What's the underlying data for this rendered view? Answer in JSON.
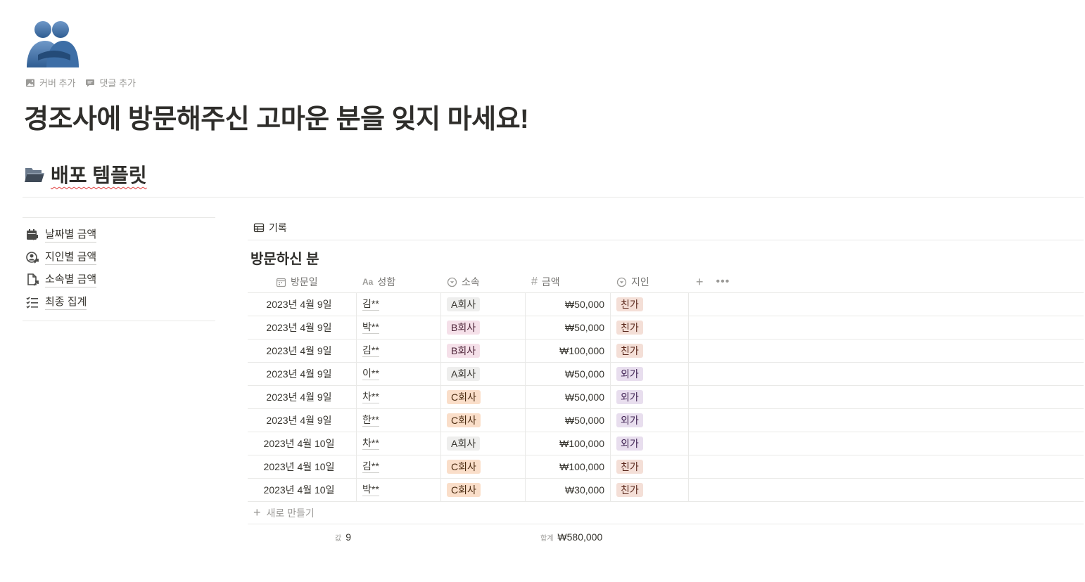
{
  "page": {
    "title": "경조사에 방문해주신 고마운 분을 잊지 마세요!",
    "add_cover": "커버 추가",
    "add_comment": "댓글 추가",
    "icon": "people-hugging-icon"
  },
  "section": {
    "icon": "open-folder-icon",
    "title": "배포 템플릿"
  },
  "sidebar": {
    "items": [
      {
        "label": "날짜별 금액",
        "icon": "calendar-link-icon"
      },
      {
        "label": "지인별 금액",
        "icon": "person-link-icon"
      },
      {
        "label": "소속별 금액",
        "icon": "document-link-icon"
      },
      {
        "label": "최종 집계",
        "icon": "checklist-icon"
      }
    ]
  },
  "database": {
    "view_tab": "기록",
    "title": "방문하신 분",
    "columns": {
      "date": "방문일",
      "name_prefix": "Aa",
      "name": "성함",
      "org": "소속",
      "amount": "금액",
      "relation": "지인"
    },
    "rows": [
      {
        "date": "2023년 4월 9일",
        "name": "김**",
        "org": "A회사",
        "amount": "₩50,000",
        "relation": "친가"
      },
      {
        "date": "2023년 4월 9일",
        "name": "박**",
        "org": "B회사",
        "amount": "₩50,000",
        "relation": "친가"
      },
      {
        "date": "2023년 4월 9일",
        "name": "김**",
        "org": "B회사",
        "amount": "₩100,000",
        "relation": "친가"
      },
      {
        "date": "2023년 4월 9일",
        "name": "이**",
        "org": "A회사",
        "amount": "₩50,000",
        "relation": "외가"
      },
      {
        "date": "2023년 4월 9일",
        "name": "차**",
        "org": "C회사",
        "amount": "₩50,000",
        "relation": "외가"
      },
      {
        "date": "2023년 4월 9일",
        "name": "한**",
        "org": "C회사",
        "amount": "₩50,000",
        "relation": "외가"
      },
      {
        "date": "2023년 4월 10일",
        "name": "차**",
        "org": "A회사",
        "amount": "₩100,000",
        "relation": "외가"
      },
      {
        "date": "2023년 4월 10일",
        "name": "김**",
        "org": "C회사",
        "amount": "₩100,000",
        "relation": "친가"
      },
      {
        "date": "2023년 4월 10일",
        "name": "박**",
        "org": "C회사",
        "amount": "₩30,000",
        "relation": "친가"
      }
    ],
    "new_row": "새로 만들기",
    "count_label": "값",
    "count_value": "9",
    "sum_label": "합계",
    "sum_value": "₩580,000"
  },
  "tag_colors": {
    "A회사": {
      "bg": "#eeeeed",
      "fg": "#37352f"
    },
    "B회사": {
      "bg": "#f5e0e9",
      "fg": "#4c2337"
    },
    "C회사": {
      "bg": "#fadec9",
      "fg": "#49290e"
    },
    "친가": {
      "bg": "#f4dfd7",
      "fg": "#5c2a1e"
    },
    "외가": {
      "bg": "#e8deee",
      "fg": "#412454"
    }
  }
}
